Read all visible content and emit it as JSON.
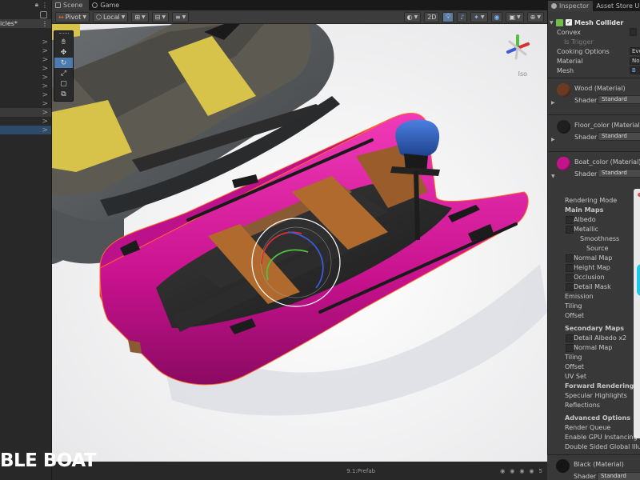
{
  "hierarchy": {
    "scene_name": "icles*",
    "rows": [
      ">",
      ">",
      ">",
      ">",
      ">",
      ">",
      ">",
      ">",
      ">",
      ">",
      ">"
    ]
  },
  "scene_tabs": [
    {
      "label": "Scene",
      "active": true
    },
    {
      "label": "Game",
      "active": false
    }
  ],
  "toolbar": {
    "pivot_label": "Pivot",
    "local_label": "Local",
    "mode_2d": "2D"
  },
  "viewport": {
    "gizmo_label": "Iso",
    "watermark": "BLE BOAT",
    "status_text": "9.1:Prefab",
    "status_count": "5",
    "boat_color": "#d61a9e",
    "floor_color": "#b06a2e",
    "engine_color": "#2e5fc0"
  },
  "tools": [
    "hand-tool",
    "move-tool",
    "rotate-tool",
    "scale-tool",
    "rect-tool",
    "transform-tool"
  ],
  "inspector": {
    "tabs": [
      {
        "label": "Inspector",
        "active": true
      },
      {
        "label": "Asset Store Up",
        "active": false
      }
    ],
    "mesh_collider": {
      "title": "Mesh Collider",
      "props": [
        {
          "label": "Convex",
          "value": ""
        },
        {
          "label": "Is Trigger",
          "value": ""
        },
        {
          "label": "Cooking Options",
          "value": "Eve"
        },
        {
          "label": "Material",
          "value": "Nor"
        },
        {
          "label": "Mesh",
          "value": "B"
        }
      ]
    },
    "materials_top": [
      {
        "name": "Wood (Material)",
        "shader_label": "Shader",
        "shader": "Standard",
        "color": "#6b3a22"
      },
      {
        "name": "Floor_color (Material)",
        "shader_label": "Shader",
        "shader": "Standard",
        "color": "#1e1e1e"
      },
      {
        "name": "Boat_color (Material)",
        "shader_label": "Shader",
        "shader": "Standard",
        "color": "#c4148c"
      }
    ],
    "rendering_mode": "Rendering Mode",
    "main_maps": "Main Maps",
    "albedo": "Albedo",
    "metallic": "Metallic",
    "smoothness": "Smoothness",
    "source": "Source",
    "normal_map": "Normal Map",
    "height_map": "Height Map",
    "occlusion": "Occlusion",
    "detail_mask": "Detail Mask",
    "emission": "Emission",
    "tiling": "Tiling",
    "offset": "Offset",
    "secondary_maps": "Secondary Maps",
    "detail_albedo": "Detail Albedo x2",
    "normal_map_2": "Normal Map",
    "tiling_2": "Tiling",
    "offset_2": "Offset",
    "uv_set": "UV Set",
    "forward_rendering": "Forward Rendering Opti",
    "specular_highlights": "Specular Highlights",
    "reflections": "Reflections",
    "advanced_options": "Advanced Options",
    "render_queue": "Render Queue",
    "gpu_instancing": "Enable GPU Instancing",
    "double_sided": "Double Sided Global Illum",
    "black_material": {
      "name": "Black (Material)",
      "shader_label": "Shader",
      "shader": "Standard",
      "color": "#151515"
    }
  }
}
